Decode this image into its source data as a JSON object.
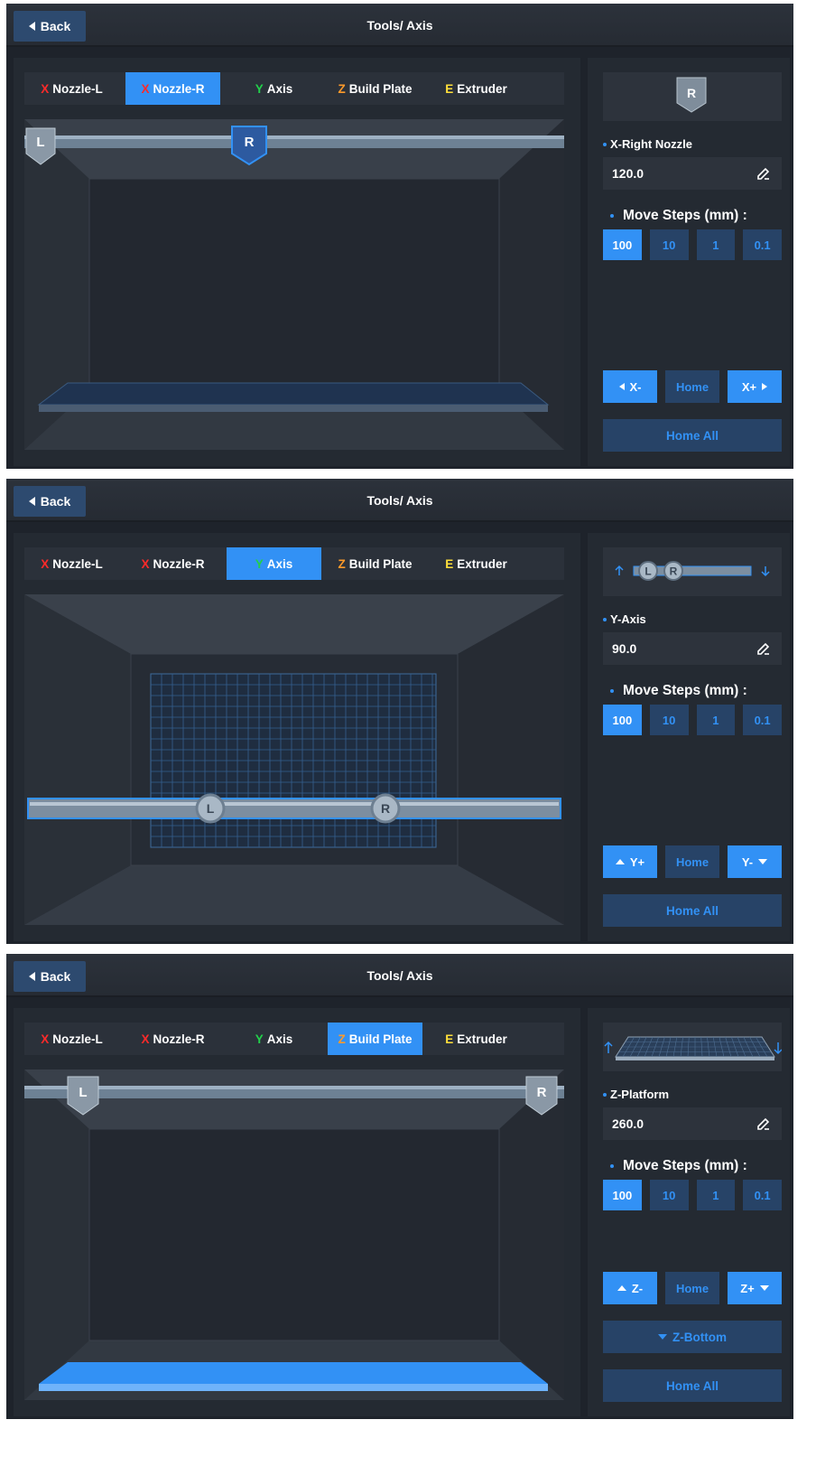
{
  "colors": {
    "accent": "#3291f5",
    "axis_x": "#ff2a2a",
    "axis_y": "#22d04a",
    "axis_z": "#ff9a2a",
    "axis_e": "#ffe03a"
  },
  "screens": [
    {
      "back_label": "Back",
      "title": "Tools/ Axis",
      "tabs": [
        {
          "axis": "X",
          "label": "Nozzle-L"
        },
        {
          "axis": "X",
          "label": "Nozzle-R"
        },
        {
          "axis": "Y",
          "label": "Axis"
        },
        {
          "axis": "Z",
          "label": "Build Plate"
        },
        {
          "axis": "E",
          "label": "Extruder"
        }
      ],
      "active_tab": 1,
      "preview_badge": "R",
      "field_label": "X-Right Nozzle",
      "field_value": "120.0",
      "steps_label": "Move Steps (mm) :",
      "steps": [
        "100",
        "10",
        "1",
        "0.1"
      ],
      "active_step": 0,
      "move_minus": "X-",
      "move_home": "Home",
      "move_plus": "X+",
      "home_all": "Home All",
      "nozzle_l_badge": "L",
      "nozzle_r_badge": "R"
    },
    {
      "back_label": "Back",
      "title": "Tools/ Axis",
      "tabs": [
        {
          "axis": "X",
          "label": "Nozzle-L"
        },
        {
          "axis": "X",
          "label": "Nozzle-R"
        },
        {
          "axis": "Y",
          "label": "Axis"
        },
        {
          "axis": "Z",
          "label": "Build Plate"
        },
        {
          "axis": "E",
          "label": "Extruder"
        }
      ],
      "active_tab": 2,
      "preview_badges": [
        "L",
        "R"
      ],
      "field_label": "Y-Axis",
      "field_value": "90.0",
      "steps_label": "Move Steps (mm) :",
      "steps": [
        "100",
        "10",
        "1",
        "0.1"
      ],
      "active_step": 0,
      "move_minus": "Y+",
      "move_home": "Home",
      "move_plus": "Y-",
      "home_all": "Home All",
      "nozzle_l_badge": "L",
      "nozzle_r_badge": "R"
    },
    {
      "back_label": "Back",
      "title": "Tools/ Axis",
      "tabs": [
        {
          "axis": "X",
          "label": "Nozzle-L"
        },
        {
          "axis": "X",
          "label": "Nozzle-R"
        },
        {
          "axis": "Y",
          "label": "Axis"
        },
        {
          "axis": "Z",
          "label": "Build Plate"
        },
        {
          "axis": "E",
          "label": "Extruder"
        }
      ],
      "active_tab": 3,
      "field_label": "Z-Platform",
      "field_value": "260.0",
      "steps_label": "Move Steps (mm) :",
      "steps": [
        "100",
        "10",
        "1",
        "0.1"
      ],
      "active_step": 0,
      "move_minus": "Z-",
      "move_home": "Home",
      "move_plus": "Z+",
      "z_bottom": "Z-Bottom",
      "home_all": "Home All",
      "nozzle_l_badge": "L",
      "nozzle_r_badge": "R"
    }
  ]
}
